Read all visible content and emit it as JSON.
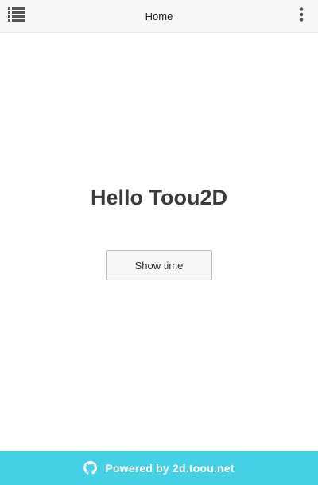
{
  "header": {
    "title": "Home",
    "menu_icon": "list-menu-icon",
    "more_icon": "more-vertical-icon"
  },
  "main": {
    "heading": "Hello Toou2D",
    "show_time_label": "Show time"
  },
  "footer": {
    "icon": "github-icon",
    "text": "Powered by 2d.toou.net"
  },
  "colors": {
    "header_bg": "#f7f7f7",
    "footer_bg": "#45d0e6",
    "heading_text": "#3b3b3b",
    "footer_text": "#ffffff",
    "icon": "#555555"
  }
}
